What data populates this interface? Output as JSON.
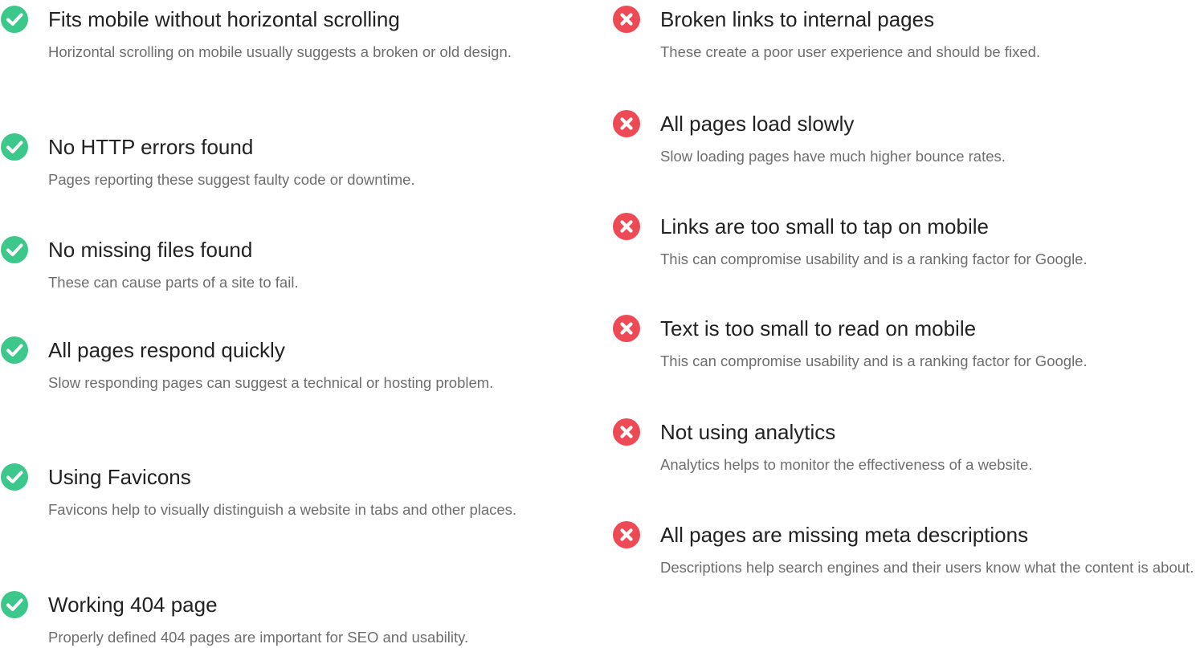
{
  "colors": {
    "pass": "#3cc78b",
    "fail": "#ee4a56",
    "title": "#222222",
    "description": "#6e6e6e"
  },
  "passed": [
    {
      "icon": "check-circle-icon",
      "title": "Fits mobile without horizontal scrolling",
      "description": "Horizontal scrolling on mobile usually suggests a broken or old design."
    },
    {
      "icon": "check-circle-icon",
      "title": "No HTTP errors found",
      "description": "Pages reporting these suggest faulty code or downtime."
    },
    {
      "icon": "check-circle-icon",
      "title": "No missing files found",
      "description": "These can cause parts of a site to fail."
    },
    {
      "icon": "check-circle-icon",
      "title": "All pages respond quickly",
      "description": "Slow responding pages can suggest a technical or hosting problem."
    },
    {
      "icon": "check-circle-icon",
      "title": "Using Favicons",
      "description": "Favicons help to visually distinguish a website in tabs and other places."
    },
    {
      "icon": "check-circle-icon",
      "title": "Working 404 page",
      "description": "Properly defined 404 pages are important for SEO and usability."
    }
  ],
  "failed": [
    {
      "icon": "x-circle-icon",
      "title": "Broken links to internal pages",
      "description": "These create a poor user experience and should be fixed."
    },
    {
      "icon": "x-circle-icon",
      "title": "All pages load slowly",
      "description": "Slow loading pages have much higher bounce rates."
    },
    {
      "icon": "x-circle-icon",
      "title": "Links are too small to tap on mobile",
      "description": "This can compromise usability and is a ranking factor for Google."
    },
    {
      "icon": "x-circle-icon",
      "title": "Text is too small to read on mobile",
      "description": "This can compromise usability and is a ranking factor for Google."
    },
    {
      "icon": "x-circle-icon",
      "title": "Not using analytics",
      "description": "Analytics helps to monitor the effectiveness of a website."
    },
    {
      "icon": "x-circle-icon",
      "title": "All pages are missing meta descriptions",
      "description": "Descriptions help search engines and their users know what the content is about."
    }
  ]
}
